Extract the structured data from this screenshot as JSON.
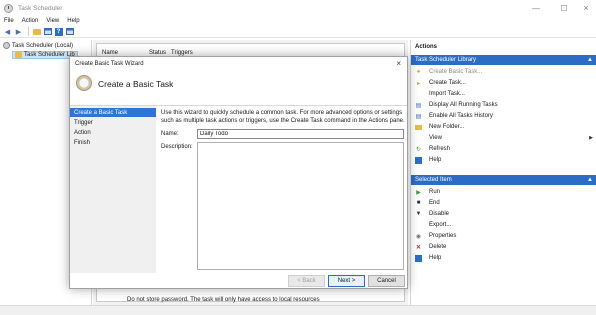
{
  "window": {
    "title": "Task Scheduler"
  },
  "menu": {
    "items": [
      "File",
      "Action",
      "View",
      "Help"
    ]
  },
  "toolbar": {
    "buttons": [
      "back-icon",
      "forward-icon",
      "folder-icon",
      "console-icon",
      "help-icon",
      "grid-icon"
    ]
  },
  "tree": {
    "root": "Task Scheduler (Local)",
    "library": "Task Scheduler Lib"
  },
  "center": {
    "columns": {
      "name": "Name",
      "status": "Status",
      "triggers": "Triggers"
    }
  },
  "actions": {
    "title": "Actions",
    "library_section": "Task Scheduler Library",
    "library_items": [
      {
        "label": "Create Basic Task...",
        "icon": "create-basic-task-icon",
        "disabled": true
      },
      {
        "label": "Create Task...",
        "icon": "create-task-icon"
      },
      {
        "label": "Import Task...",
        "icon": "import-icon"
      },
      {
        "label": "Display All Running Tasks",
        "icon": "running-tasks-icon"
      },
      {
        "label": "Enable All Tasks History",
        "icon": "history-icon"
      },
      {
        "label": "New Folder...",
        "icon": "new-folder-icon"
      },
      {
        "label": "View",
        "icon": "view-icon",
        "submenu": true
      },
      {
        "label": "Refresh",
        "icon": "refresh-icon"
      },
      {
        "label": "Help",
        "icon": "help-icon"
      }
    ],
    "selected_section": "Selected Item",
    "selected_items": [
      {
        "label": "Run",
        "icon": "run-icon"
      },
      {
        "label": "End",
        "icon": "end-icon"
      },
      {
        "label": "Disable",
        "icon": "disable-icon"
      },
      {
        "label": "Export...",
        "icon": "export-icon"
      },
      {
        "label": "Properties",
        "icon": "properties-icon"
      },
      {
        "label": "Delete",
        "icon": "delete-icon"
      },
      {
        "label": "Help",
        "icon": "help-icon"
      }
    ]
  },
  "dialog": {
    "title": "Create Basic Task Wizard",
    "header": "Create a Basic Task",
    "steps": [
      "Create a Basic Task",
      "Trigger",
      "Action",
      "Finish"
    ],
    "active_step": 0,
    "description": "Use this wizard to quickly schedule a common task.  For more advanced options or settings such as multiple task actions or triggers, use the Create Task command in the Actions pane.",
    "name_label": "Name:",
    "name_value": "Daily Todo",
    "description_label": "Description:",
    "description_value": "",
    "back_label": "< Back",
    "next_label": "Next >",
    "cancel_label": "Cancel"
  },
  "background": {
    "hidden_text": "Do not store password.  The task will only have access to local resources"
  },
  "colors": {
    "accent": "#2e75d6",
    "section_header": "#2b6cc4"
  }
}
